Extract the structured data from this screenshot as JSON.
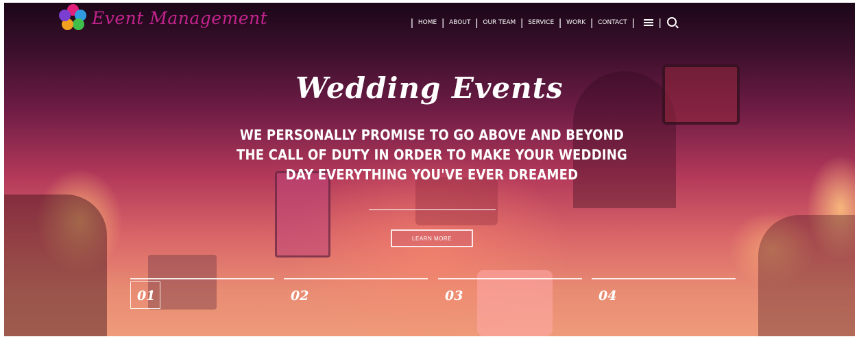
{
  "brand": {
    "name": "Event Management"
  },
  "nav": {
    "items": [
      "HOME",
      "ABOUT",
      "OUR TEAM",
      "SERVICE",
      "WORK",
      "CONTACT"
    ],
    "icons": [
      "list-icon",
      "search-icon"
    ]
  },
  "hero": {
    "title": "Wedding Events",
    "tagline": "WE PERSONALLY PROMISE TO GO ABOVE AND BEYOND THE CALL OF DUTY IN ORDER TO MAKE YOUR WEDDING DAY EVERYTHING YOU'VE EVER DREAMED",
    "cta_label": "LEARN MORE"
  },
  "slides": {
    "items": [
      "01",
      "02",
      "03",
      "04"
    ],
    "active": "01"
  },
  "colors": {
    "brand": "#c2248c",
    "text": "#ffffff"
  }
}
